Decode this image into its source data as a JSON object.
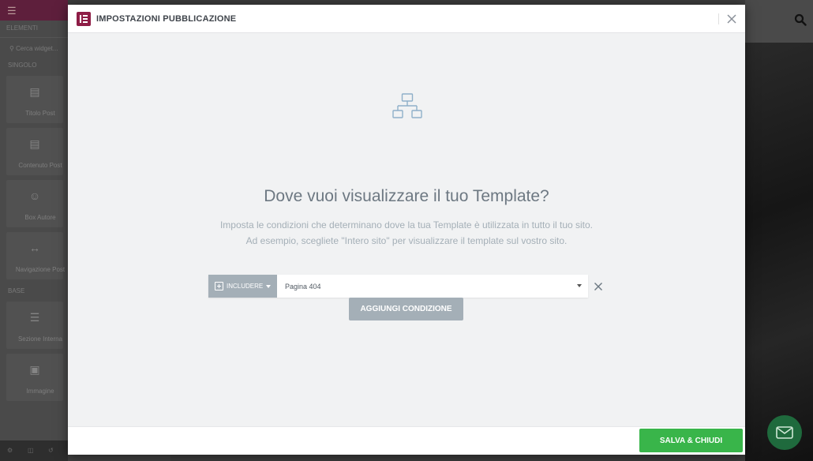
{
  "modal": {
    "title": "IMPOSTAZIONI PUBBLICAZIONE",
    "headline": "Dove vuoi visualizzare il tuo Template?",
    "description_line1": "Imposta le condizioni che determinano dove la tua Template è utilizzata in tutto il tuo sito.",
    "description_line2": "Ad esempio, scegliete \"Intero sito\" per visualizzare il template sul vostro sito.",
    "condition": {
      "type_label": "INCLUDERE",
      "value": "Pagina 404"
    },
    "add_condition_label": "AGGIUNGI CONDIZIONE",
    "save_label": "SALVA & CHIUDI"
  },
  "background": {
    "tab_label": "ELEMENTI",
    "search_placeholder": "Cerca widget...",
    "category_single": "SINGOLO",
    "category_base": "BASE",
    "widgets": [
      {
        "label": "Titolo Post",
        "icon": "title-icon"
      },
      {
        "label": "Contenuto Post",
        "icon": "content-icon"
      },
      {
        "label": "Box Autore",
        "icon": "author-icon"
      },
      {
        "label": "Navigazione Post",
        "icon": "navigation-icon"
      },
      {
        "label": "Sezione Interna",
        "icon": "inner-section-icon"
      },
      {
        "label": "Immagine",
        "icon": "image-icon"
      }
    ]
  },
  "colors": {
    "brand": "#8e1d46",
    "save_green": "#39b54a",
    "muted_button": "#a4afb7"
  }
}
